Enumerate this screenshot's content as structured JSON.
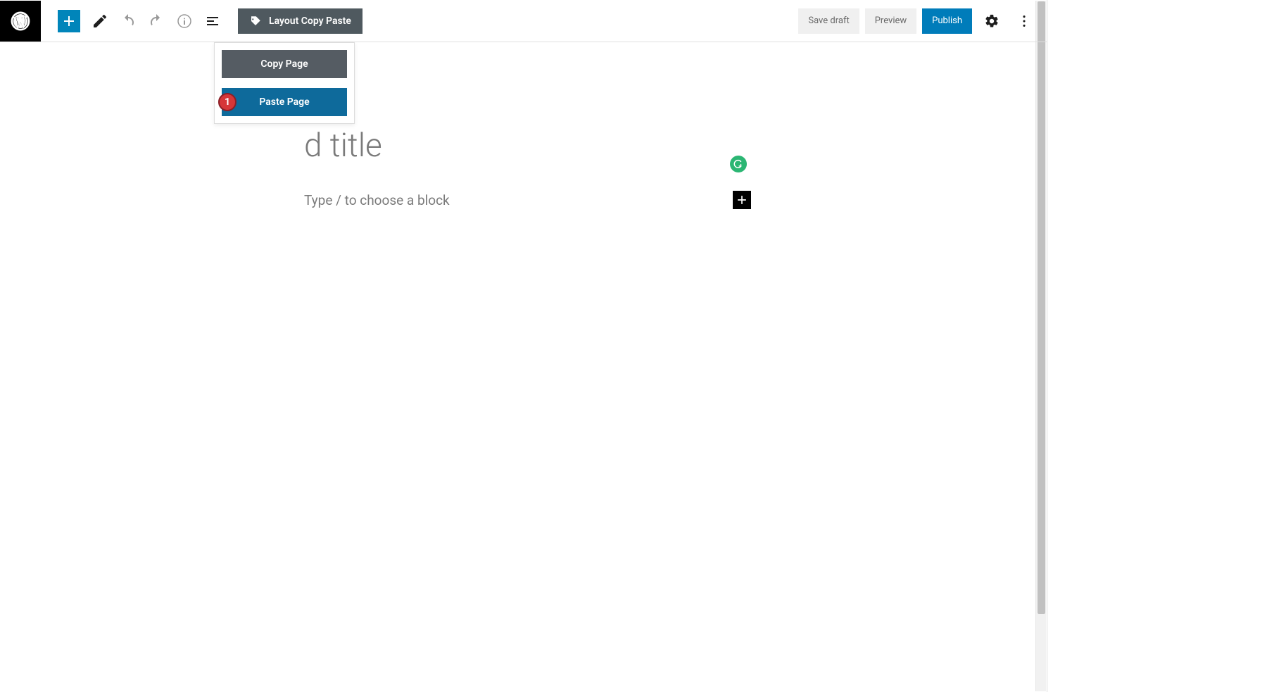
{
  "toolbar": {
    "layout_button_label": "Layout Copy Paste",
    "save_draft_label": "Save draft",
    "preview_label": "Preview",
    "publish_label": "Publish"
  },
  "dropdown": {
    "copy_label": "Copy Page",
    "paste_label": "Paste Page",
    "annotation_number": "1"
  },
  "editor": {
    "title_placeholder": "d title",
    "block_placeholder": "Type / to choose a block"
  }
}
